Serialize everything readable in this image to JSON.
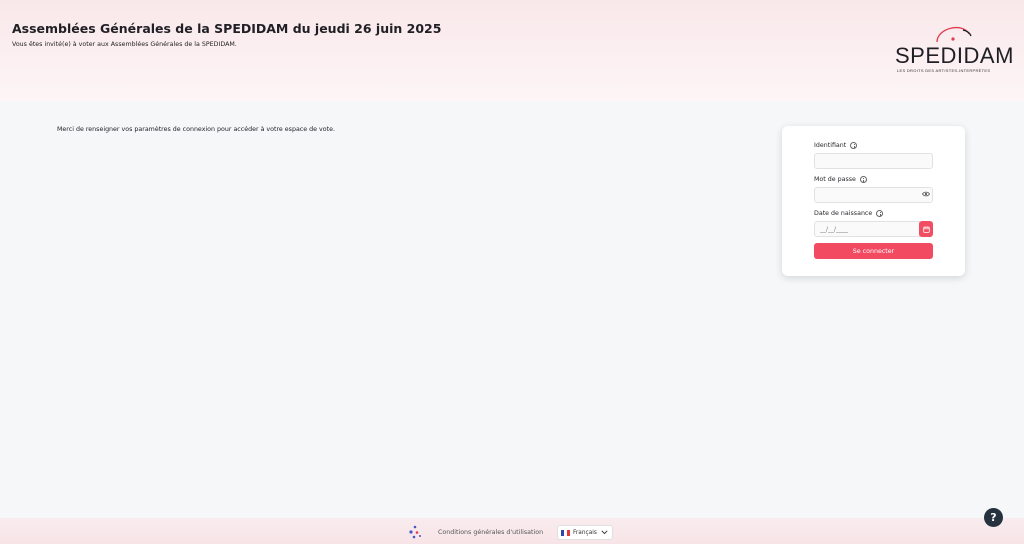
{
  "header": {
    "title": "Assemblées Générales de la SPEDIDAM du jeudi 26 juin 2025",
    "subtitle": "Vous êtes invité(e) à voter aux Assemblées Générales de la SPEDIDAM."
  },
  "logo": {
    "wordmark": "SPEDIDAM",
    "tagline": "LES DROITS DES ARTISTES-INTERPRÈTES",
    "accent_color": "#e23a4e"
  },
  "intro_text": "Merci de renseigner vos paramètres de connexion pour accéder à votre espace de vote.",
  "login": {
    "identifier_label": "Identifiant",
    "identifier_value": "",
    "password_label": "Mot de passe",
    "password_value": "",
    "birthdate_label": "Date de naissance",
    "birthdate_placeholder": "__/__/____",
    "submit_label": "Se connecter",
    "icons": {
      "info": "info-icon",
      "password_toggle": "eye-icon",
      "calendar": "calendar-icon"
    }
  },
  "footer": {
    "cgu_label": "Conditions générales d'utilisation",
    "language_selected": "Français",
    "help_label": "?"
  },
  "colors": {
    "primary": "#f24a61",
    "text": "#1f1f24",
    "help_button": "#26323e",
    "background": "#f6f7f9"
  }
}
